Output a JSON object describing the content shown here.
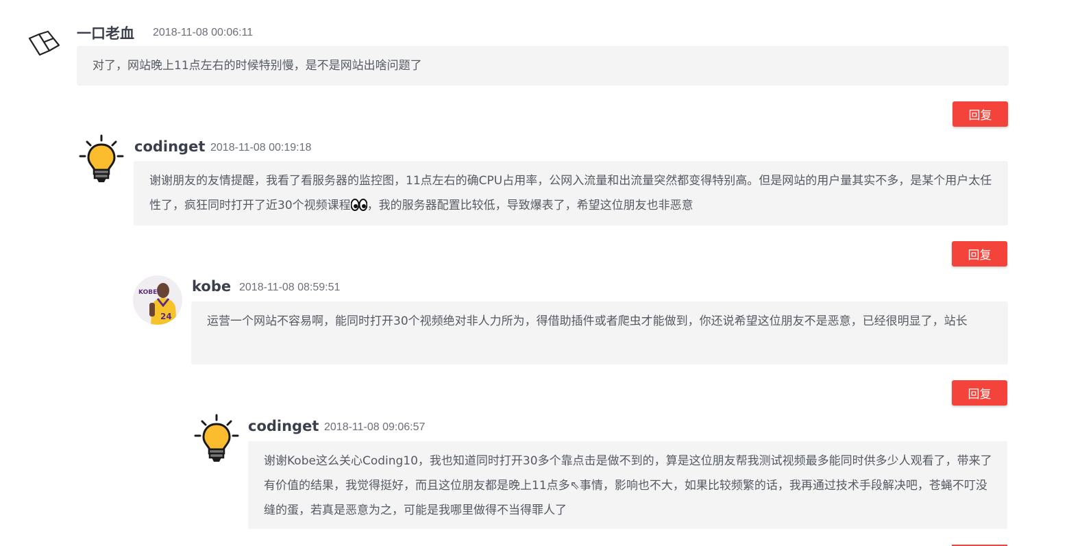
{
  "comments": [
    {
      "author": "一口老血",
      "timestamp": "2018-11-08 00:06:11",
      "text": "对了，网站晚上11点左右的时候特别慢，是不是网站出啥问题了",
      "reply_label": "回复",
      "avatar_icon": "laravel-logo-icon"
    },
    {
      "author": "codinget",
      "timestamp": "2018-11-08 00:19:18",
      "text_before_emoji": "谢谢朋友的友情提醒，我看了看服务器的监控图，11点左右的确CPU占用率，公网入流量和出流量突然都变得特别高。但是网站的用户量其实不多，是某个用户太任性了，疯狂同时打开了近30个视频课程",
      "text_after_emoji": "，我的服务器配置比较低，导致爆表了，希望这位朋友也非恶意",
      "reply_label": "回复",
      "avatar_icon": "lightbulb-icon",
      "emoji_icon": "eyes-emoji-icon"
    },
    {
      "author": "kobe",
      "timestamp": "2018-11-08 08:59:51",
      "text": "运营一个网站不容易啊，能同时打开30个视频绝对非人力所为，得借助插件或者爬虫才能做到，你还说希望这位朋友不是恶意，已经很明显了，站长",
      "reply_label": "回复",
      "avatar_icon": "kobe-avatar",
      "avatar_caption": "KOBE!",
      "jersey_number": "24"
    },
    {
      "author": "codinget",
      "timestamp": "2018-11-08 09:06:57",
      "text": "谢谢Kobe这么关心Coding10，我也知道同时打开30多个靠点击是做不到的，算是这位朋友帮我测试视频最多能同时供多少人观看了，带来了有价值的结果，我觉得挺好，而且这位朋友都是晚上11点多⇖事情，影响也不大，如果比较频繁的话，我再通过技术手段解决吧，苍蝇不叮没缝的蛋，若真是恶意为之，可能是我哪里做得不当得罪人了",
      "avatar_icon": "lightbulb-icon"
    }
  ],
  "colors": {
    "reply_button": "#f4433a",
    "bubble_bg": "#f4f4f5",
    "author_text": "#3a3f4b",
    "bulb_yellow": "#fbbd2e"
  }
}
